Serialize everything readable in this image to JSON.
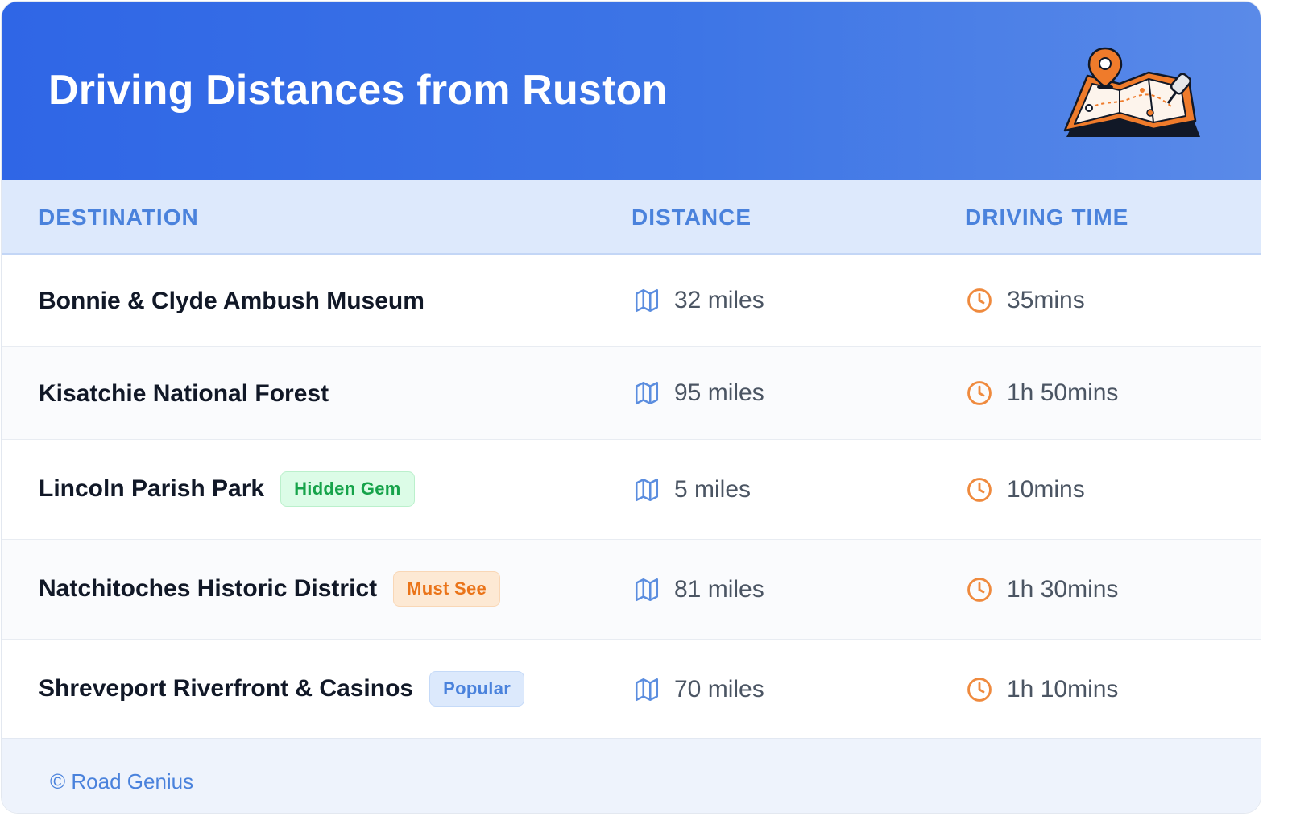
{
  "header": {
    "title": "Driving Distances from Ruston",
    "illustration": "map-with-location-pin-icon"
  },
  "columns": {
    "destination": "DESTINATION",
    "distance": "DISTANCE",
    "driving_time": "DRIVING TIME"
  },
  "rows": [
    {
      "destination": "Bonnie & Clyde Ambush Museum",
      "badge": "",
      "distance": "32 miles",
      "time": "35mins"
    },
    {
      "destination": "Kisatchie National Forest",
      "badge": "",
      "distance": "95 miles",
      "time": "1h 50mins"
    },
    {
      "destination": "Lincoln Parish Park",
      "badge": "Hidden Gem",
      "distance": "5 miles",
      "time": "10mins"
    },
    {
      "destination": "Natchitoches Historic District",
      "badge": "Must See",
      "distance": "81 miles",
      "time": "1h 30mins"
    },
    {
      "destination": "Shreveport Riverfront & Casinos",
      "badge": "Popular",
      "distance": "70 miles",
      "time": "1h 10mins"
    }
  ],
  "footer": {
    "text": "© Road Genius"
  },
  "colors": {
    "header_blue": "#2f66e6",
    "accent_blue": "#4a82dc",
    "clock_orange": "#ef8a3e",
    "badge_green": "#16a34a",
    "badge_orange": "#ea7419"
  },
  "icons": {
    "distance": "map-icon",
    "time": "clock-icon"
  }
}
